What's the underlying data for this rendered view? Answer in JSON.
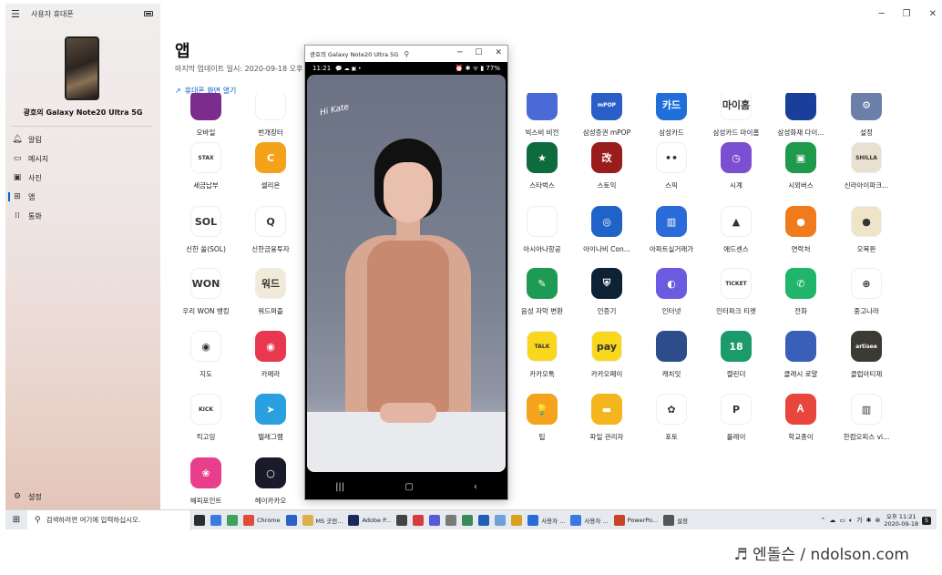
{
  "sidebar": {
    "title": "사용자 휴대폰",
    "device_name": "광호의 Galaxy Note20 Ultra 5G",
    "nav": [
      {
        "label": "알림",
        "icon": "bell-icon"
      },
      {
        "label": "메시지",
        "icon": "message-icon"
      },
      {
        "label": "사진",
        "icon": "photo-icon"
      },
      {
        "label": "앱",
        "icon": "apps-grid-icon"
      },
      {
        "label": "통화",
        "icon": "dialpad-icon"
      }
    ],
    "active_nav": "앱",
    "settings_label": "설정"
  },
  "main": {
    "title": "앱",
    "updated": "마지막 업데이트 일시: 2020-09-18 오후 11",
    "open_screen": "휴대폰 화면 열기"
  },
  "apps": [
    {
      "name": "모바일",
      "color": "#7b2c8c",
      "text": ""
    },
    {
      "name": "번개장터",
      "color": "#ffffff",
      "text": ""
    },
    {
      "name": "빅스비 비전",
      "color": "#4b6ad6",
      "text": ""
    },
    {
      "name": "삼성증권 mPOP",
      "color": "#2a5fc7",
      "text": "mPOP"
    },
    {
      "name": "삼성카드",
      "color": "#1e6fd9",
      "text": "카드"
    },
    {
      "name": "삼성카드 마이홈",
      "color": "#ffffff",
      "text": "마이홈"
    },
    {
      "name": "삼성화재 다이...",
      "color": "#1a3f9a",
      "text": ""
    },
    {
      "name": "설정",
      "color": "#6b7fa8",
      "text": "⚙"
    },
    {
      "name": "세금납부",
      "color": "#ffffff",
      "text": "STAX"
    },
    {
      "name": "셀리온",
      "color": "#f4a21a",
      "text": "C"
    },
    {
      "name": "스타벅스",
      "color": "#0d6b3e",
      "text": "★"
    },
    {
      "name": "스토익",
      "color": "#9a1d1d",
      "text": "改"
    },
    {
      "name": "스픽",
      "color": "#ffffff",
      "text": "••"
    },
    {
      "name": "시계",
      "color": "#7b4fd1",
      "text": "◷"
    },
    {
      "name": "시외버스",
      "color": "#1e9a4a",
      "text": "▣"
    },
    {
      "name": "신라아이파크...",
      "color": "#e8e0d0",
      "text": "SHILLA"
    },
    {
      "name": "신한 쏠(SOL)",
      "color": "#ffffff",
      "text": "SOL"
    },
    {
      "name": "신한금융투자",
      "color": "#ffffff",
      "text": "Q"
    },
    {
      "name": "아시아나항공",
      "color": "#ffffff",
      "text": ""
    },
    {
      "name": "아이나비 Con...",
      "color": "#1f63c9",
      "text": "◎"
    },
    {
      "name": "아파트실거래가",
      "color": "#2a6ad9",
      "text": "▥"
    },
    {
      "name": "애드센스",
      "color": "#ffffff",
      "text": "▲"
    },
    {
      "name": "연락처",
      "color": "#f07b1c",
      "text": "●"
    },
    {
      "name": "오목판",
      "color": "#efe3c8",
      "text": "●"
    },
    {
      "name": "우리 WON 뱅킹",
      "color": "#ffffff",
      "text": "WON"
    },
    {
      "name": "워드퍼즐",
      "color": "#f2ead8",
      "text": "워드"
    },
    {
      "name": "음성 자막 변환",
      "color": "#1e9a54",
      "text": "✎"
    },
    {
      "name": "인증기",
      "color": "#0e2235",
      "text": "⛨"
    },
    {
      "name": "인터넷",
      "color": "#6a5be0",
      "text": "◐"
    },
    {
      "name": "인터파크 티켓",
      "color": "#ffffff",
      "text": "TICKET"
    },
    {
      "name": "전화",
      "color": "#20b56a",
      "text": "✆"
    },
    {
      "name": "중고나라",
      "color": "#ffffff",
      "text": "⊕"
    },
    {
      "name": "지도",
      "color": "#ffffff",
      "text": "◉"
    },
    {
      "name": "카메라",
      "color": "#e8384f",
      "text": "◉"
    },
    {
      "name": "카카오톡",
      "color": "#f9d71c",
      "text": "TALK"
    },
    {
      "name": "카카오페이",
      "color": "#f9d71c",
      "text": "pay"
    },
    {
      "name": "캐치잇",
      "color": "#2d4d8a",
      "text": ""
    },
    {
      "name": "캘린더",
      "color": "#1b9a6a",
      "text": "18"
    },
    {
      "name": "클래시 로얄",
      "color": "#3a5fb8",
      "text": ""
    },
    {
      "name": "클럽아티제",
      "color": "#3b3a33",
      "text": "artisee"
    },
    {
      "name": "킥고잉",
      "color": "#ffffff",
      "text": "KICK"
    },
    {
      "name": "텔레그램",
      "color": "#2aa0e0",
      "text": "➤"
    },
    {
      "name": "팁",
      "color": "#f5a21c",
      "text": "💡"
    },
    {
      "name": "파일 관리자",
      "color": "#f5b51c",
      "text": "▬"
    },
    {
      "name": "포토",
      "color": "#ffffff",
      "text": "✿"
    },
    {
      "name": "플레이",
      "color": "#ffffff",
      "text": "P"
    },
    {
      "name": "학교종이",
      "color": "#e8453c",
      "text": "Ꭺ"
    },
    {
      "name": "한컴오피스 vi...",
      "color": "#ffffff",
      "text": "▥"
    },
    {
      "name": "해피포인트",
      "color": "#e83e8c",
      "text": "❀"
    },
    {
      "name": "헤이카카오",
      "color": "#1a1a2a",
      "text": "○"
    }
  ],
  "phone_window": {
    "title": "광호의 Galaxy Note20 Ultra 5G",
    "status_time": "11:21",
    "status_icons": "💬 ☁ ▣ •",
    "status_right": "⏰ ✱ ᯤ ▮ 77%",
    "video_text": "Hi Kate"
  },
  "taskbar": {
    "search_placeholder": "검색하려면 여기에 입력하십시오.",
    "items": [
      {
        "label": "",
        "color": "#2d2d2d"
      },
      {
        "label": "",
        "color": "#3b7be0"
      },
      {
        "label": "",
        "color": "#40a35a"
      },
      {
        "label": "Chrome",
        "color": "#e04b3a"
      },
      {
        "label": "",
        "color": "#2a62c9"
      },
      {
        "label": "MS 굿윈...",
        "color": "#d9b34a"
      },
      {
        "label": "Adobe P...",
        "color": "#1b2a5a"
      },
      {
        "label": "",
        "color": "#444444"
      },
      {
        "label": "",
        "color": "#d83b3b"
      },
      {
        "label": "",
        "color": "#5a5ad8"
      },
      {
        "label": "",
        "color": "#7a7a7a"
      },
      {
        "label": "",
        "color": "#3a8a5a"
      },
      {
        "label": "",
        "color": "#1f5fb8"
      },
      {
        "label": "",
        "color": "#6fa0d8"
      },
      {
        "label": "",
        "color": "#d8a020"
      },
      {
        "label": "사용자 ...",
        "color": "#2d6ad9"
      },
      {
        "label": "사용자 ...",
        "color": "#3a7ae0"
      },
      {
        "label": "PowerPo...",
        "color": "#c8452a"
      },
      {
        "label": "설정",
        "color": "#555555"
      }
    ],
    "clock_time": "오후 11:21",
    "clock_date": "2020-09-18",
    "notification_count": "5"
  },
  "watermark": "♬ 엔돌슨 / ndolson.com"
}
